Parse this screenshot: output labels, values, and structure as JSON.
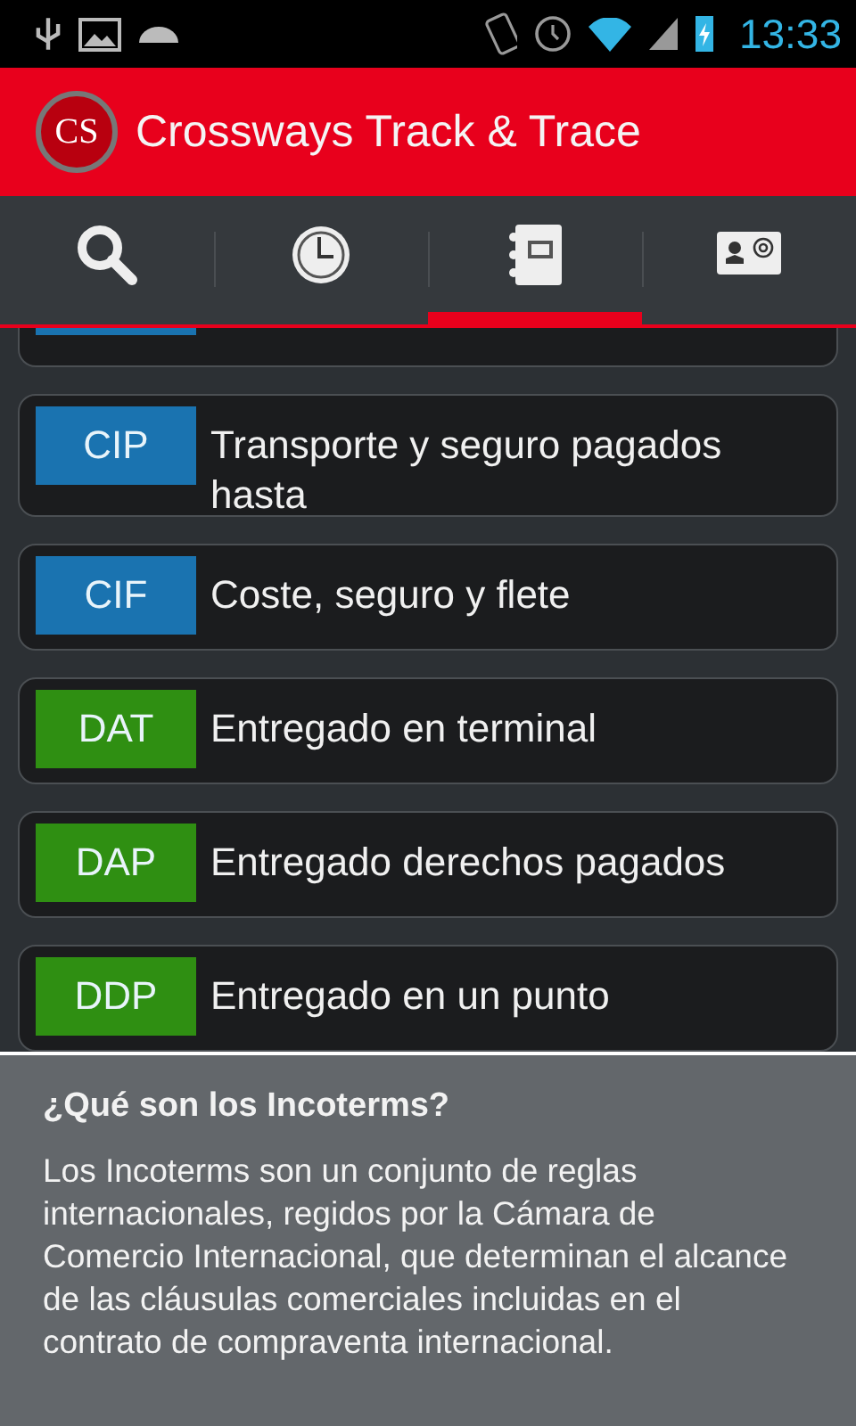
{
  "status_bar": {
    "time": "13:33"
  },
  "app_bar": {
    "logo": "CS",
    "title": "Crossways Track & Trace"
  },
  "tabs": [
    {
      "kind": "search",
      "selected": false
    },
    {
      "kind": "history",
      "selected": false
    },
    {
      "kind": "notebook",
      "selected": true
    },
    {
      "kind": "contacts",
      "selected": false
    }
  ],
  "partial_item": {
    "color": "#1a73b0"
  },
  "items": [
    {
      "code": "CIP",
      "label": "Transporte y seguro pagados hasta",
      "color": "#1a73b0"
    },
    {
      "code": "CIF",
      "label": "Coste, seguro y flete",
      "color": "#1a73b0"
    },
    {
      "code": "DAT",
      "label": "Entregado en terminal",
      "color": "#2f8f12"
    },
    {
      "code": "DAP",
      "label": "Entregado derechos pagados",
      "color": "#2f8f12"
    },
    {
      "code": "DDP",
      "label": "Entregado en un punto",
      "color": "#2f8f12"
    }
  ],
  "info": {
    "title": "¿Qué son los Incoterms?",
    "body": "Los Incoterms son un conjunto de reglas internacionales, regidos por la Cámara de Comercio Internacional, que determinan el alcance de las cláusulas comerciales incluidas en el contrato de compraventa internacional."
  }
}
